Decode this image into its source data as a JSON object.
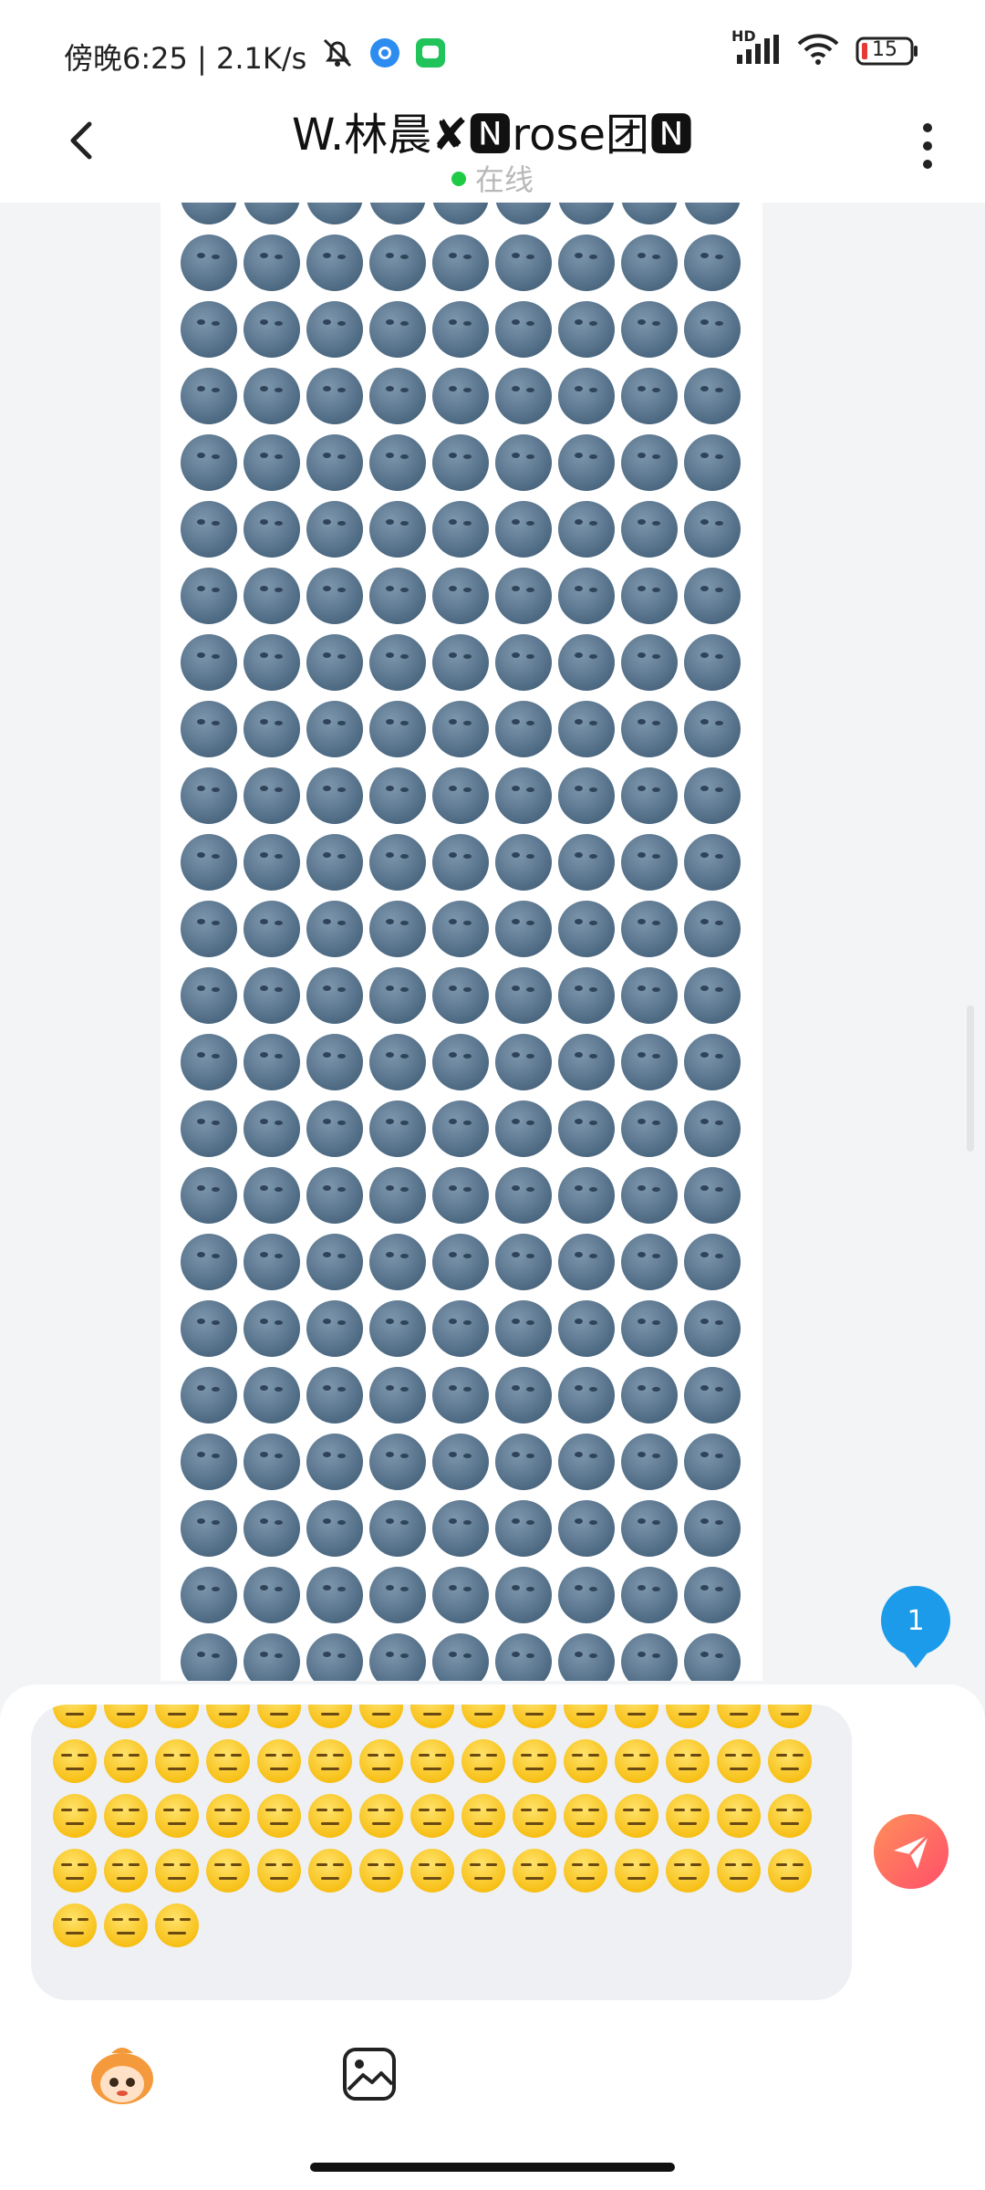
{
  "status_bar": {
    "time_text": "傍晚6:25 | 2.1K/s",
    "hd_label": "HD",
    "battery": "15"
  },
  "header": {
    "title": "W.林晨✘🅽rose团🅽",
    "status": "在线"
  },
  "chat": {
    "received_emoji": "🌚",
    "received_columns": 9,
    "received_rows": 23,
    "new_message_count": "1"
  },
  "composer": {
    "input_emoji": "😑",
    "input_columns": 15
  },
  "colors": {
    "online": "#1fcb46",
    "badge": "#1c9bea",
    "send_gradient_start": "#ff8f5a",
    "send_gradient_end": "#ff4f6a"
  },
  "icons": [
    "back-arrow-icon",
    "more-vertical-icon",
    "send-icon",
    "mascot-avatar-icon",
    "image-icon"
  ]
}
